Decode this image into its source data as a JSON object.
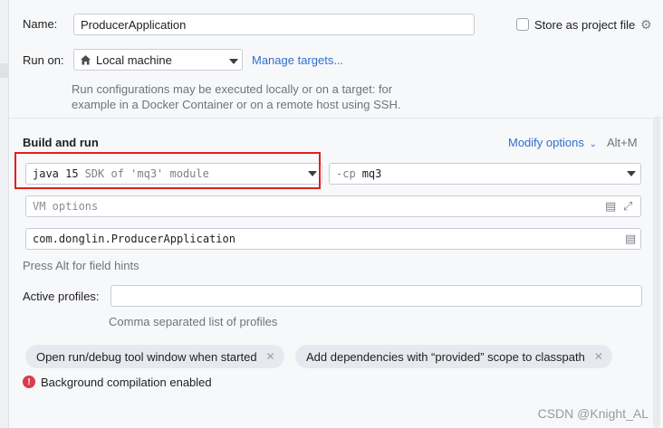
{
  "form": {
    "name_label": "Name:",
    "name_value": "ProducerApplication",
    "store_label": "Store as project file",
    "run_on_label": "Run on:",
    "run_on_value": "Local machine",
    "manage_targets": "Manage targets...",
    "run_on_hint_line1": "Run configurations may be executed locally or on a target: for",
    "run_on_hint_line2": "example in a Docker Container or on a remote host using SSH."
  },
  "build_run": {
    "title": "Build and run",
    "modify_options": "Modify options",
    "modify_shortcut": "Alt+M",
    "jdk_version": "java 15",
    "jdk_desc": "SDK of 'mq3' module",
    "cp_flag": "-cp",
    "cp_module": "mq3",
    "vm_options_placeholder": "VM options",
    "main_class": "com.donglin.ProducerApplication",
    "field_hint": "Press Alt for field hints",
    "active_profiles_label": "Active profiles:",
    "active_profiles_value": "",
    "profiles_hint": "Comma separated list of profiles"
  },
  "chips": [
    {
      "label": "Open run/debug tool window when started"
    },
    {
      "label": "Add dependencies with “provided” scope to classpath"
    }
  ],
  "status": {
    "background_compilation": "Background compilation enabled"
  },
  "watermark": "CSDN @Knight_AL",
  "colors": {
    "accent_link": "#2f6fcf",
    "highlight_box": "#e02020",
    "error": "#db3b4b"
  },
  "icons": {
    "home": "home-icon",
    "gear": "gear-icon",
    "expand": "expand-icon",
    "document": "document-icon",
    "close": "close-icon",
    "error": "error-icon",
    "dropdown": "chevron-down-icon"
  }
}
